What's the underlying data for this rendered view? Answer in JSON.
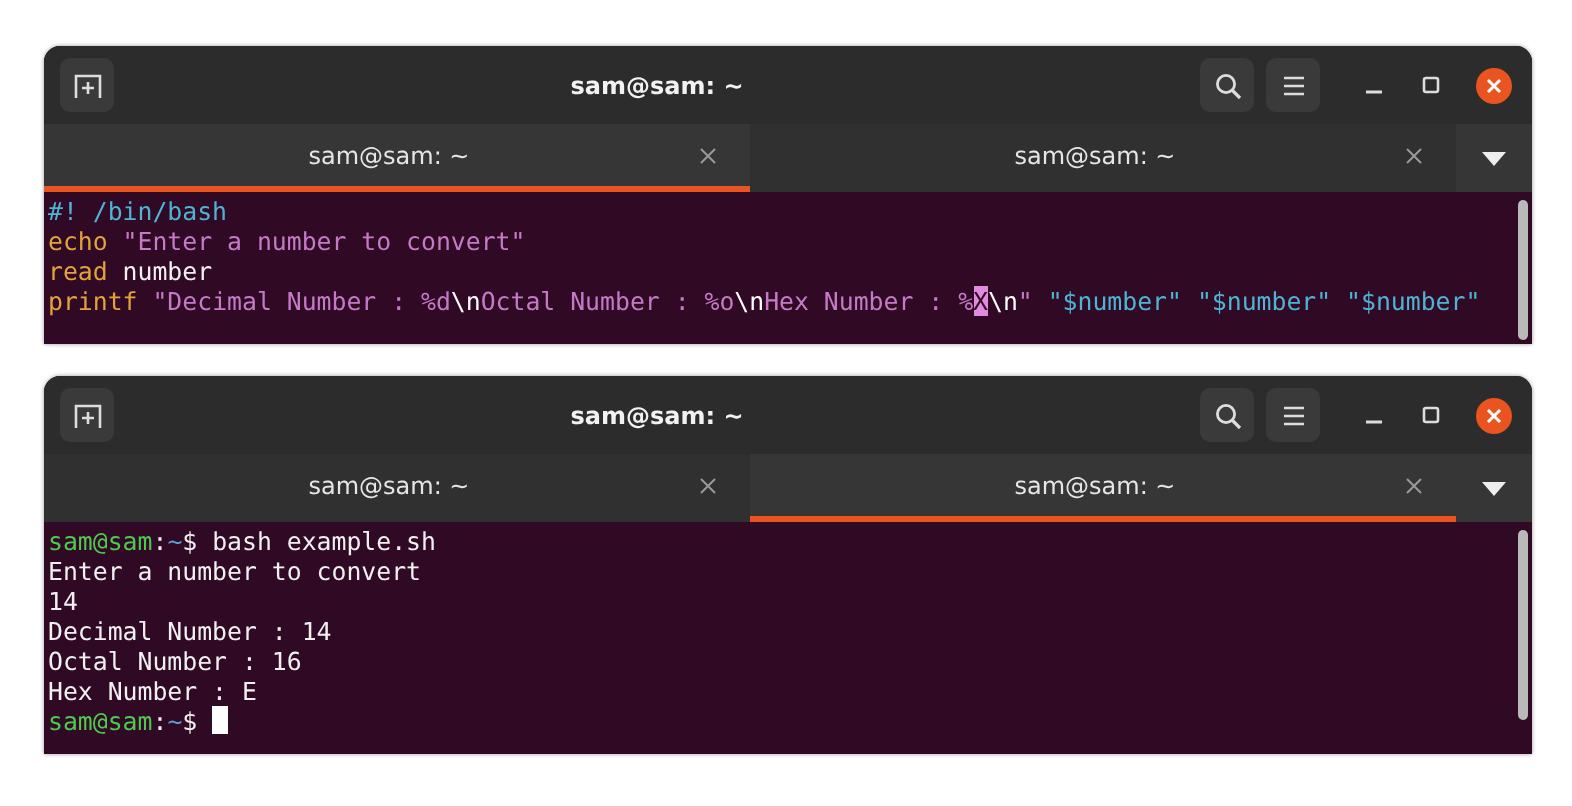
{
  "windows": [
    {
      "title": "sam@sam: ~",
      "tabs": [
        {
          "label": "sam@sam: ~",
          "selected": true
        },
        {
          "label": "sam@sam: ~",
          "selected": false
        }
      ],
      "lines": [
        [
          {
            "kind": "comment",
            "text": "#! /bin/bash"
          }
        ],
        [
          {
            "kind": "keyword",
            "text": "echo"
          },
          {
            "kind": "string",
            "text": " \"Enter a number to convert\""
          }
        ],
        [
          {
            "kind": "keyword",
            "text": "read"
          },
          {
            "kind": "plain",
            "text": " number"
          }
        ],
        [
          {
            "kind": "keyword",
            "text": "printf"
          },
          {
            "kind": "string",
            "text": " \"Decimal Number : %d"
          },
          {
            "kind": "escape",
            "text": "\\n"
          },
          {
            "kind": "string",
            "text": "Octal Number : %o"
          },
          {
            "kind": "escape",
            "text": "\\n"
          },
          {
            "kind": "string",
            "text": "Hex Number : %"
          },
          {
            "kind": "cursor",
            "text": "X"
          },
          {
            "kind": "escape",
            "text": "\\n"
          },
          {
            "kind": "string",
            "text": "\" "
          },
          {
            "kind": "variable",
            "text": "\"$number\" \"$number\" \"$number\""
          }
        ]
      ]
    },
    {
      "title": "sam@sam: ~",
      "tabs": [
        {
          "label": "sam@sam: ~",
          "selected": false
        },
        {
          "label": "sam@sam: ~",
          "selected": true
        }
      ],
      "lines": [
        [
          {
            "kind": "prompt-user",
            "text": "sam@sam"
          },
          {
            "kind": "plain",
            "text": ":"
          },
          {
            "kind": "prompt-path",
            "text": "~"
          },
          {
            "kind": "plain",
            "text": "$ bash example.sh"
          }
        ],
        [
          {
            "kind": "plain",
            "text": "Enter a number to convert"
          }
        ],
        [
          {
            "kind": "plain",
            "text": "14"
          }
        ],
        [
          {
            "kind": "plain",
            "text": "Decimal Number : 14"
          }
        ],
        [
          {
            "kind": "plain",
            "text": "Octal Number : 16"
          }
        ],
        [
          {
            "kind": "plain",
            "text": "Hex Number : E"
          }
        ],
        [
          {
            "kind": "prompt-user",
            "text": "sam@sam"
          },
          {
            "kind": "plain",
            "text": ":"
          },
          {
            "kind": "prompt-path",
            "text": "~"
          },
          {
            "kind": "plain",
            "text": "$ "
          },
          {
            "kind": "block-cursor"
          }
        ]
      ]
    }
  ]
}
